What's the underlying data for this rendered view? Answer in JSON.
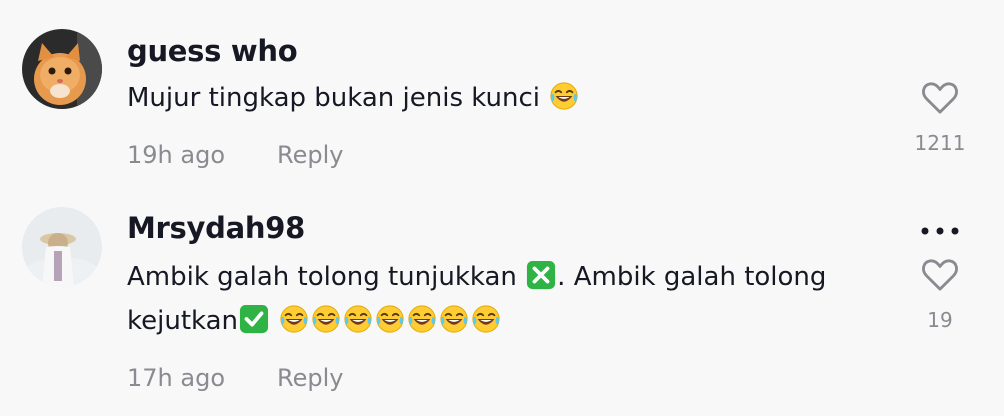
{
  "comments": [
    {
      "username": "guess who",
      "text_before": "Mujur tingkap bukan jenis kunci",
      "timestamp": "19h ago",
      "reply_label": "Reply",
      "likes": "1211",
      "avatar_icon": "cat-avatar"
    },
    {
      "username": "Mrsydah98",
      "line1_part1": "Ambik galah tolong tunjukkan",
      "line1_part2": ". Ambik galah tolong",
      "line2_part1": "kejutkan",
      "timestamp": "17h ago",
      "reply_label": "Reply",
      "likes": "19",
      "avatar_icon": "person-hat-avatar"
    }
  ],
  "icons": {
    "laughing": "face-with-tears-of-joy-emoji",
    "cross": "cross-mark-button-emoji",
    "check": "check-mark-button-emoji",
    "heart": "heart-outline-icon",
    "more": "more-options-icon"
  },
  "colors": {
    "background": "#f8f8f8",
    "text": "#161823",
    "muted": "#8a8b91",
    "emoji_green": "#2fb344"
  }
}
